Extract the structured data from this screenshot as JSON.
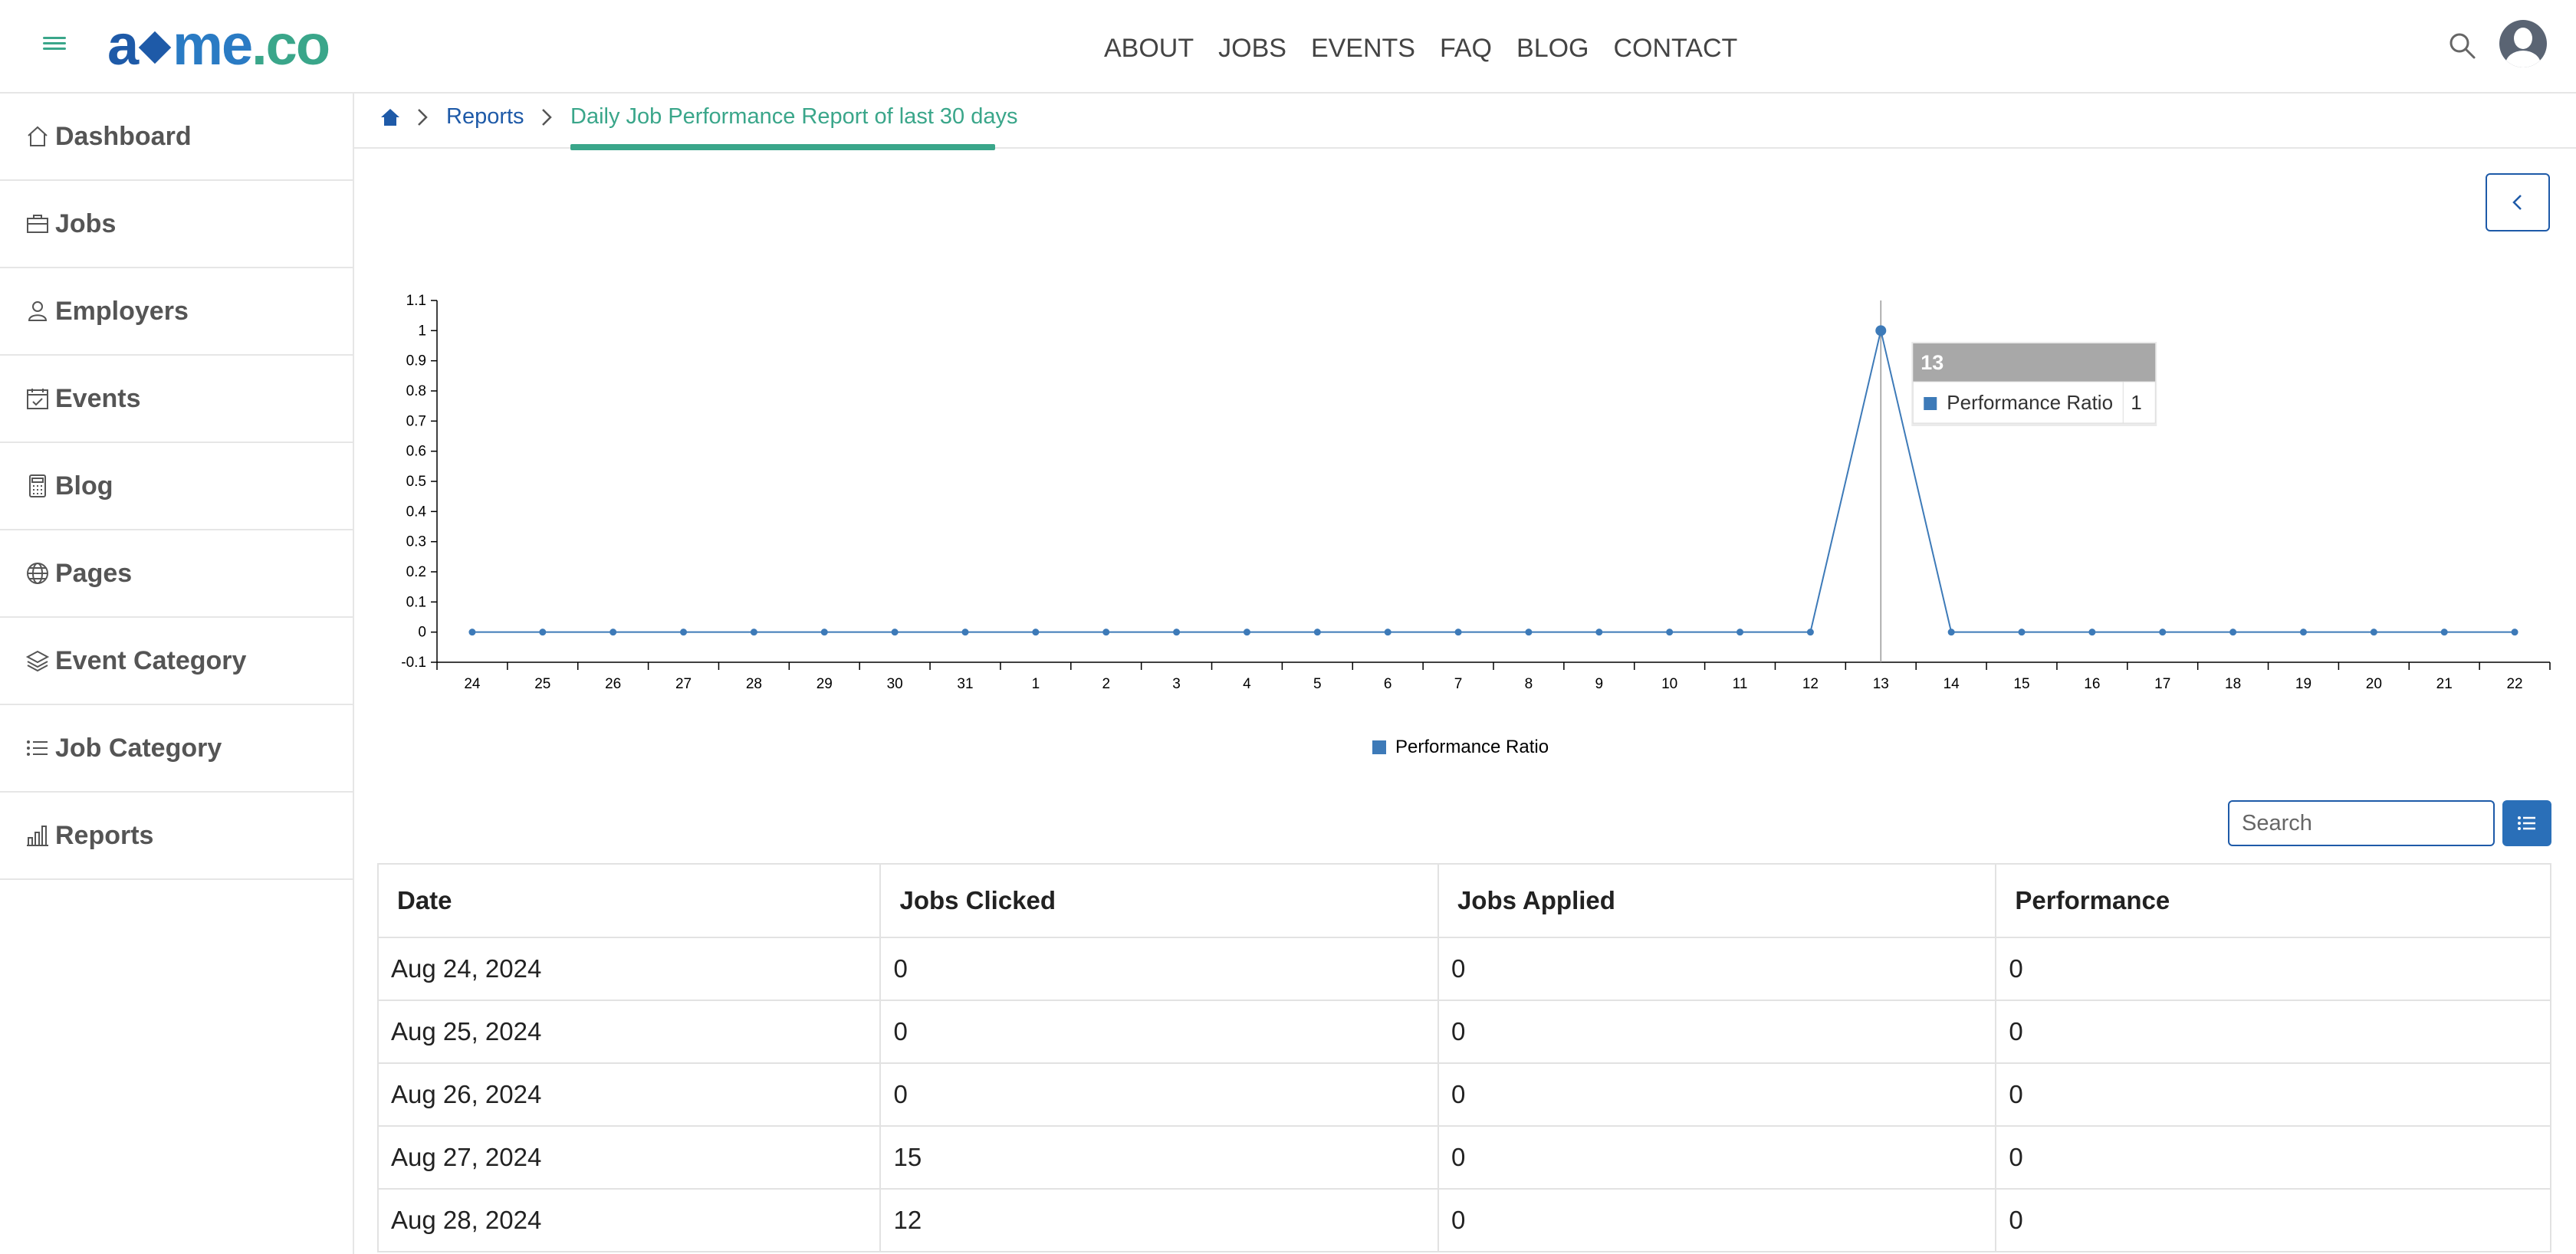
{
  "header": {
    "logo": {
      "part1": "a",
      "part2": "me",
      "part3": ".co"
    },
    "nav": [
      "ABOUT",
      "JOBS",
      "EVENTS",
      "FAQ",
      "BLOG",
      "CONTACT"
    ]
  },
  "sidebar": {
    "items": [
      {
        "label": "Dashboard",
        "icon": "home-icon"
      },
      {
        "label": "Jobs",
        "icon": "briefcase-icon"
      },
      {
        "label": "Employers",
        "icon": "user-icon"
      },
      {
        "label": "Events",
        "icon": "calendar-icon"
      },
      {
        "label": "Blog",
        "icon": "calculator-icon"
      },
      {
        "label": "Pages",
        "icon": "globe-icon"
      },
      {
        "label": "Event Category",
        "icon": "layers-icon"
      },
      {
        "label": "Job Category",
        "icon": "list-icon"
      },
      {
        "label": "Reports",
        "icon": "bar-chart-icon"
      }
    ]
  },
  "breadcrumb": {
    "parent": "Reports",
    "current": "Daily Job Performance Report of last 30 days"
  },
  "colors": {
    "primary": "#1e5aa8",
    "accent": "#3aa68a",
    "series": "#3d7ab8"
  },
  "chart_data": {
    "type": "line",
    "x": [
      "24",
      "25",
      "26",
      "27",
      "28",
      "29",
      "30",
      "31",
      "1",
      "2",
      "3",
      "4",
      "5",
      "6",
      "7",
      "8",
      "9",
      "10",
      "11",
      "12",
      "13",
      "14",
      "15",
      "16",
      "17",
      "18",
      "19",
      "20",
      "21",
      "22"
    ],
    "series": [
      {
        "name": "Performance Ratio",
        "values": [
          0,
          0,
          0,
          0,
          0,
          0,
          0,
          0,
          0,
          0,
          0,
          0,
          0,
          0,
          0,
          0,
          0,
          0,
          0,
          0,
          1,
          0,
          0,
          0,
          0,
          0,
          0,
          0,
          0,
          0
        ]
      }
    ],
    "y_ticks": [
      "-0.1",
      "0",
      "0.1",
      "0.2",
      "0.3",
      "0.4",
      "0.5",
      "0.6",
      "0.7",
      "0.8",
      "0.9",
      "1",
      "1.1"
    ],
    "ylim": [
      -0.1,
      1.1
    ],
    "legend": "bottom",
    "tooltip": {
      "title": "13",
      "label": "Performance Ratio",
      "value": "1"
    }
  },
  "table": {
    "search_placeholder": "Search",
    "headers": [
      "Date",
      "Jobs Clicked",
      "Jobs Applied",
      "Performance"
    ],
    "rows": [
      [
        "Aug 24, 2024",
        "0",
        "0",
        "0"
      ],
      [
        "Aug 25, 2024",
        "0",
        "0",
        "0"
      ],
      [
        "Aug 26, 2024",
        "0",
        "0",
        "0"
      ],
      [
        "Aug 27, 2024",
        "15",
        "0",
        "0"
      ],
      [
        "Aug 28, 2024",
        "12",
        "0",
        "0"
      ]
    ]
  }
}
